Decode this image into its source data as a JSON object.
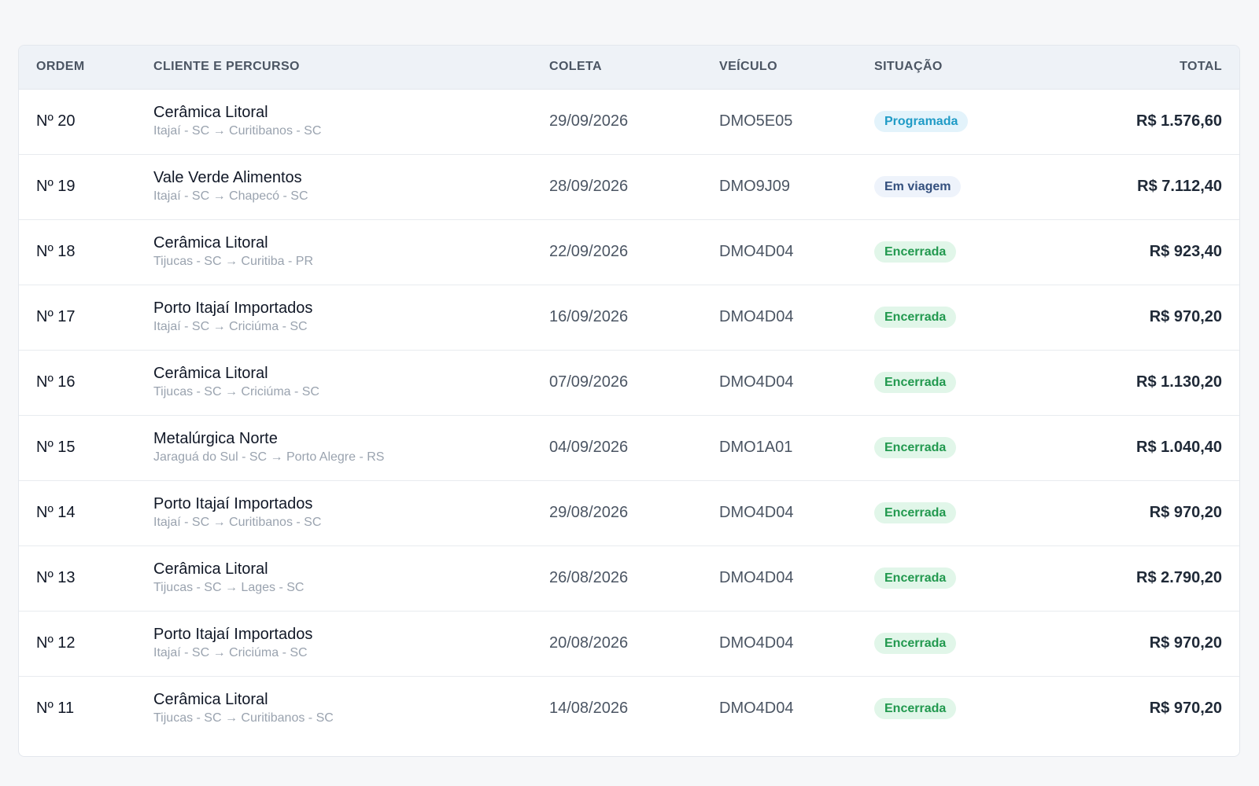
{
  "table": {
    "headers": {
      "ordem": "ORDEM",
      "cliente": "CLIENTE E PERCURSO",
      "coleta": "COLETA",
      "veiculo": "VEÍCULO",
      "situacao": "SITUAÇÃO",
      "total": "TOTAL"
    },
    "rows": [
      {
        "ordem": "Nº 20",
        "cliente": "Cerâmica Litoral",
        "rota": "Itajaí - SC → Curitibanos - SC",
        "coleta": "29/09/2026",
        "veiculo": "DMO5E05",
        "situacao": "Programada",
        "status": "programada",
        "total": "R$ 1.576,60"
      },
      {
        "ordem": "Nº 19",
        "cliente": "Vale Verde Alimentos",
        "rota": "Itajaí - SC → Chapecó - SC",
        "coleta": "28/09/2026",
        "veiculo": "DMO9J09",
        "situacao": "Em viagem",
        "status": "viagem",
        "total": "R$ 7.112,40"
      },
      {
        "ordem": "Nº 18",
        "cliente": "Cerâmica Litoral",
        "rota": "Tijucas - SC → Curitiba - PR",
        "coleta": "22/09/2026",
        "veiculo": "DMO4D04",
        "situacao": "Encerrada",
        "status": "encerrada",
        "total": "R$ 923,40"
      },
      {
        "ordem": "Nº 17",
        "cliente": "Porto Itajaí Importados",
        "rota": "Itajaí - SC → Criciúma - SC",
        "coleta": "16/09/2026",
        "veiculo": "DMO4D04",
        "situacao": "Encerrada",
        "status": "encerrada",
        "total": "R$ 970,20"
      },
      {
        "ordem": "Nº 16",
        "cliente": "Cerâmica Litoral",
        "rota": "Tijucas - SC → Criciúma - SC",
        "coleta": "07/09/2026",
        "veiculo": "DMO4D04",
        "situacao": "Encerrada",
        "status": "encerrada",
        "total": "R$ 1.130,20"
      },
      {
        "ordem": "Nº 15",
        "cliente": "Metalúrgica Norte",
        "rota": "Jaraguá do Sul - SC → Porto Alegre - RS",
        "coleta": "04/09/2026",
        "veiculo": "DMO1A01",
        "situacao": "Encerrada",
        "status": "encerrada",
        "total": "R$ 1.040,40"
      },
      {
        "ordem": "Nº 14",
        "cliente": "Porto Itajaí Importados",
        "rota": "Itajaí - SC → Curitibanos - SC",
        "coleta": "29/08/2026",
        "veiculo": "DMO4D04",
        "situacao": "Encerrada",
        "status": "encerrada",
        "total": "R$ 970,20"
      },
      {
        "ordem": "Nº 13",
        "cliente": "Cerâmica Litoral",
        "rota": "Tijucas - SC → Lages - SC",
        "coleta": "26/08/2026",
        "veiculo": "DMO4D04",
        "situacao": "Encerrada",
        "status": "encerrada",
        "total": "R$ 2.790,20"
      },
      {
        "ordem": "Nº 12",
        "cliente": "Porto Itajaí Importados",
        "rota": "Itajaí - SC → Criciúma - SC",
        "coleta": "20/08/2026",
        "veiculo": "DMO4D04",
        "situacao": "Encerrada",
        "status": "encerrada",
        "total": "R$ 970,20"
      },
      {
        "ordem": "Nº 11",
        "cliente": "Cerâmica Litoral",
        "rota": "Tijucas - SC → Curitibanos - SC",
        "coleta": "14/08/2026",
        "veiculo": "DMO4D04",
        "situacao": "Encerrada",
        "status": "encerrada",
        "total": "R$ 970,20"
      }
    ]
  },
  "colors": {
    "programada_text": "#1f9bc6",
    "programada_bg": "#e3f3fb",
    "viagem_text": "#34507e",
    "viagem_bg": "#eef3fb",
    "encerrada_text": "#22994f",
    "encerrada_bg": "#e1f6e9"
  }
}
